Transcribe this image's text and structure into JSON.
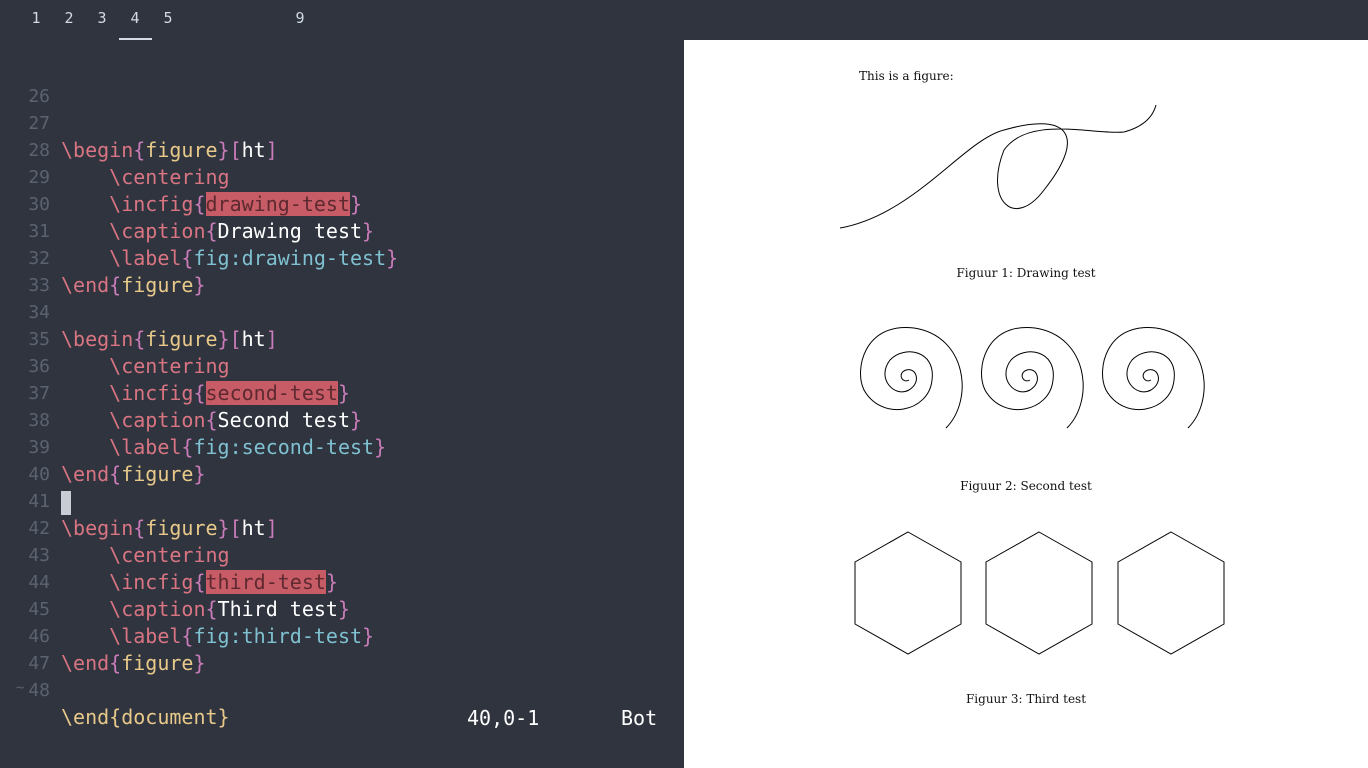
{
  "workspaces": [
    "1",
    "2",
    "3",
    "4",
    "5",
    "9"
  ],
  "active_workspace": "4",
  "editor": {
    "lines": [
      {
        "n": "26"
      },
      {
        "n": "27"
      },
      {
        "n": "28"
      },
      {
        "n": "29"
      },
      {
        "n": "30"
      },
      {
        "n": "31"
      },
      {
        "n": "32"
      },
      {
        "n": "33"
      },
      {
        "n": "34"
      },
      {
        "n": "35"
      },
      {
        "n": "36"
      },
      {
        "n": "37"
      },
      {
        "n": "38"
      },
      {
        "n": "39"
      },
      {
        "n": "40"
      },
      {
        "n": "41"
      },
      {
        "n": "42"
      },
      {
        "n": "43"
      },
      {
        "n": "44"
      },
      {
        "n": "45"
      },
      {
        "n": "46"
      },
      {
        "n": "47"
      },
      {
        "n": "48"
      }
    ],
    "tokens": {
      "begin": "\\begin",
      "end": "\\end",
      "centering": "\\centering",
      "incfig": "\\incfig",
      "caption": "\\caption",
      "label": "\\label",
      "figure": "figure",
      "ht": "ht",
      "document": "document",
      "lb": "{",
      "rb": "}",
      "lsq": "[",
      "rsq": "]",
      "fig1": "drawing-test",
      "cap1": "Drawing test",
      "lab1": "fig:drawing-test",
      "fig2": "second-test",
      "cap2": "Second test",
      "lab2": "fig:second-test",
      "fig3": "third-test",
      "cap3": "Third test",
      "lab3": "fig:third-test"
    },
    "tilde": "~",
    "status_position": "40,0-1",
    "status_scroll": "Bot"
  },
  "pdf": {
    "intro": "This is a figure:",
    "captions": [
      "Figuur 1: Drawing test",
      "Figuur 2: Second test",
      "Figuur 3: Third test"
    ]
  }
}
